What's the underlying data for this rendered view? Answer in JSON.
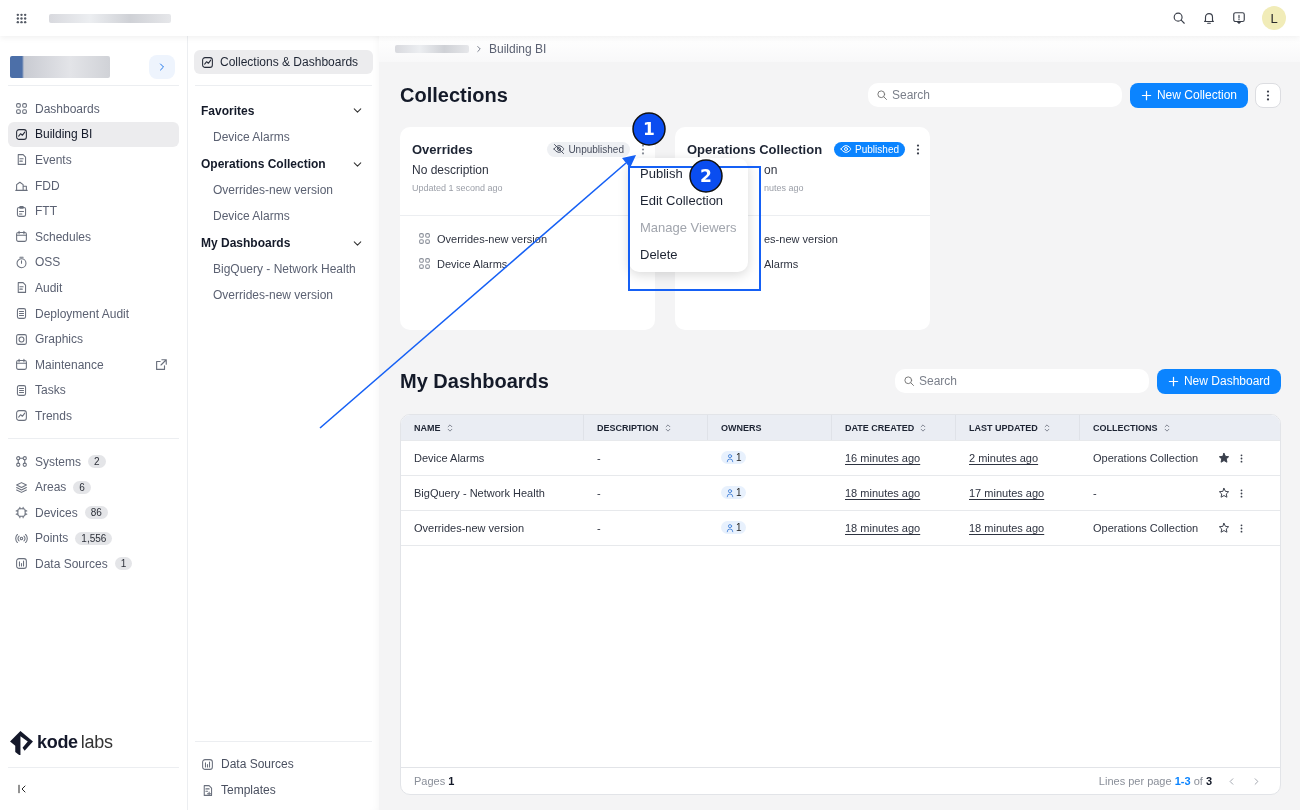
{
  "top_bar": {
    "avatar": "L"
  },
  "sidebar": {
    "nav": [
      {
        "label": "Dashboards",
        "selected": false
      },
      {
        "label": "Building BI",
        "selected": true
      },
      {
        "label": "Events",
        "selected": false
      },
      {
        "label": "FDD",
        "selected": false
      },
      {
        "label": "FTT",
        "selected": false
      },
      {
        "label": "Schedules",
        "selected": false
      },
      {
        "label": "OSS",
        "selected": false
      },
      {
        "label": "Audit",
        "selected": false
      },
      {
        "label": "Deployment Audit",
        "selected": false
      },
      {
        "label": "Graphics",
        "selected": false
      },
      {
        "label": "Maintenance",
        "selected": false,
        "external": true
      },
      {
        "label": "Tasks",
        "selected": false
      },
      {
        "label": "Trends",
        "selected": false
      }
    ],
    "entities": [
      {
        "label": "Systems",
        "count": "2"
      },
      {
        "label": "Areas",
        "count": "6"
      },
      {
        "label": "Devices",
        "count": "86"
      },
      {
        "label": "Points",
        "count": "1,556"
      },
      {
        "label": "Data Sources",
        "count": "1"
      }
    ],
    "logo": {
      "bold": "kode",
      "light": "labs"
    }
  },
  "subnav": {
    "top_item": {
      "label": "Collections & Dashboards",
      "selected": true
    },
    "groups": [
      {
        "title": "Favorites",
        "expanded": true,
        "items": [
          "Device Alarms"
        ]
      },
      {
        "title": "Operations Collection",
        "expanded": true,
        "items": [
          "Overrides-new version",
          "Device Alarms"
        ]
      },
      {
        "title": "My Dashboards",
        "expanded": true,
        "items": [
          "BigQuery - Network Health",
          "Overrides-new version"
        ]
      }
    ],
    "bottom": [
      "Data Sources",
      "Templates"
    ]
  },
  "breadcrumb": {
    "current": "Building BI"
  },
  "collections": {
    "title": "Collections",
    "search_placeholder": "Search",
    "new_button": "New Collection",
    "cards": [
      {
        "title": "Overrides",
        "status": "Unpublished",
        "published": false,
        "description": "No description",
        "updated": "Updated 1 second ago",
        "items": [
          "Overrides-new version",
          "Device Alarms"
        ],
        "menu_open": true
      },
      {
        "title": "Operations Collection",
        "status": "Published",
        "published": true,
        "description": "on",
        "updated": "nutes ago",
        "items": [
          "es-new version",
          "Alarms"
        ],
        "menu_open": false
      }
    ],
    "menu": [
      {
        "label": "Publish",
        "disabled": false
      },
      {
        "label": "Edit Collection",
        "disabled": false
      },
      {
        "label": "Manage Viewers",
        "disabled": true
      },
      {
        "label": "Delete",
        "disabled": false
      }
    ]
  },
  "dashboards": {
    "title": "My Dashboards",
    "search_placeholder": "Search",
    "new_button": "New Dashboard",
    "table": {
      "columns": [
        {
          "label": "NAME",
          "sortable": true
        },
        {
          "label": "DESCRIPTION",
          "sortable": true
        },
        {
          "label": "OWNERS",
          "sortable": false
        },
        {
          "label": "DATE CREATED",
          "sortable": true
        },
        {
          "label": "LAST UPDATED",
          "sortable": true
        },
        {
          "label": "COLLECTIONS",
          "sortable": true
        }
      ],
      "rows": [
        {
          "name": "Device Alarms",
          "description": "-",
          "owners": "1",
          "created": "16 minutes ago",
          "updated": "2 minutes ago",
          "collections": "Operations Collection",
          "favorite": true
        },
        {
          "name": "BigQuery - Network Health",
          "description": "-",
          "owners": "1",
          "created": "18 minutes ago",
          "updated": "17 minutes ago",
          "collections": "-",
          "favorite": false
        },
        {
          "name": "Overrides-new version",
          "description": "-",
          "owners": "1",
          "created": "18 minutes ago",
          "updated": "18 minutes ago",
          "collections": "Operations Collection",
          "favorite": false
        }
      ]
    },
    "footer": {
      "pages": "Pages **1**",
      "lines_label": "Lines per page",
      "range": "1-3",
      "of": "of",
      "total": "3"
    }
  },
  "annotations": {
    "arrow": true,
    "highlight_frame": true,
    "markers": [
      {
        "label": "1"
      },
      {
        "label": "2"
      }
    ]
  }
}
